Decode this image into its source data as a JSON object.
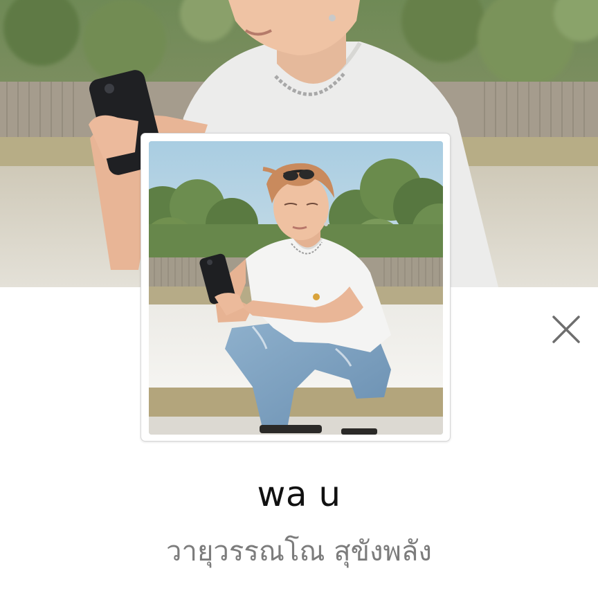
{
  "profile": {
    "display_name": "wa u",
    "full_name": "วายุวรรณโณ สุขังพลัง"
  },
  "cover_photo": {
    "description_icon": "cover-photo"
  },
  "profile_photo": {
    "description_icon": "profile-photo"
  },
  "actions": {
    "close_icon": "close-icon"
  },
  "colors": {
    "background": "#ffffff",
    "display_name_text": "#111111",
    "full_name_text": "#7c7c7c",
    "close_icon": "#6e6e6e"
  }
}
